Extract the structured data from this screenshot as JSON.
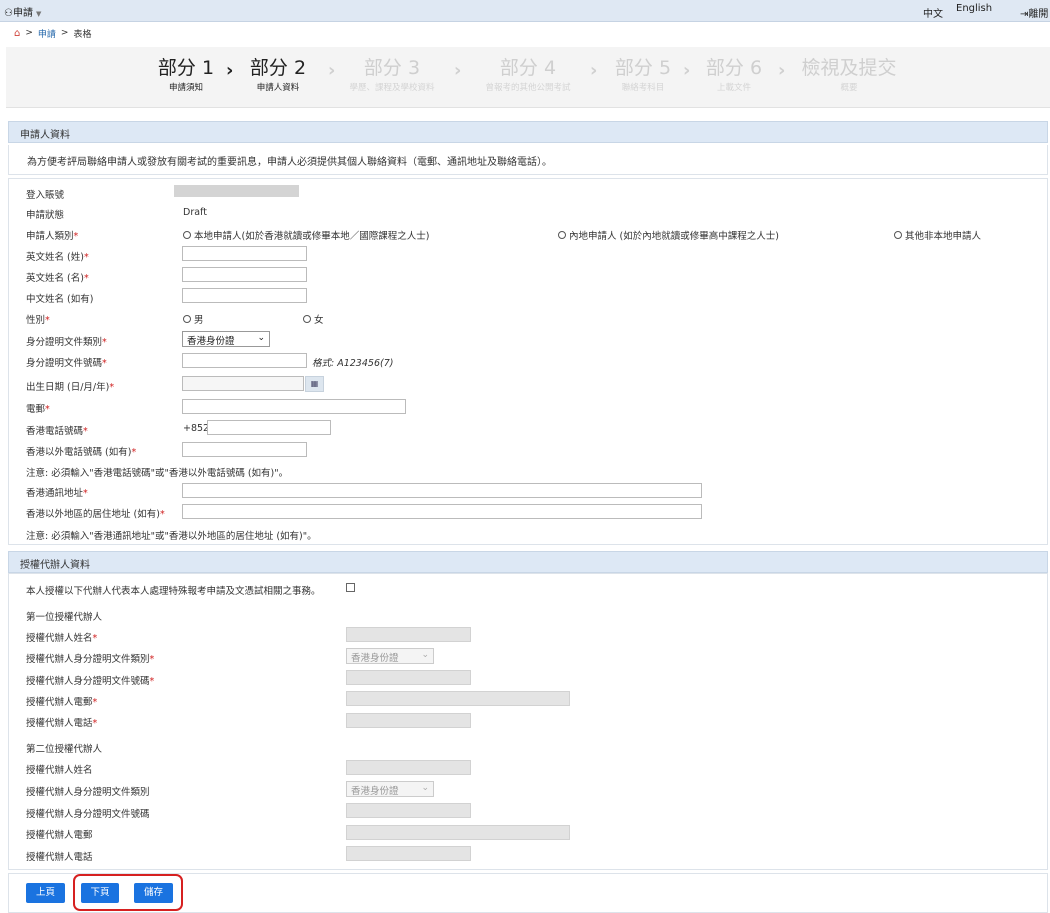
{
  "topbar": {
    "menu_label": "申請",
    "lang_zh": "中文",
    "lang_en": "English",
    "logout": "離開"
  },
  "breadcrumb": {
    "item1": "申請",
    "item2": "表格",
    "sep": ">"
  },
  "steps": [
    {
      "title": "部分 1",
      "subtitle": "申請須知"
    },
    {
      "title": "部分 2",
      "subtitle": "申請人資料"
    },
    {
      "title": "部分 3",
      "subtitle": "學歷、課程及學校資料"
    },
    {
      "title": "部分 4",
      "subtitle": "曾報考的其他公開考試"
    },
    {
      "title": "部分 5",
      "subtitle": "聯絡考科目"
    },
    {
      "title": "部分 6",
      "subtitle": "上載文件"
    },
    {
      "title": "檢視及提交",
      "subtitle": "概要"
    }
  ],
  "applicant": {
    "section_title": "申請人資料",
    "notice": "為方便考評局聯絡申請人或發放有關考試的重要訊息，申請人必須提供其個人聯絡資料（電郵、通訊地址及聯絡電話）。",
    "login_label": "登入賬號",
    "status_label": "申請狀態",
    "status_value": "Draft",
    "category_label": "申請人類別",
    "category_options": [
      "本地申請人(如於香港就讀或修畢本地／國際課程之人士)",
      "內地申請人 (如於內地就讀或修畢高中課程之人士)",
      "其他非本地申請人"
    ],
    "surname_label": "英文姓名 (姓)",
    "given_name_label": "英文姓名 (名)",
    "chinese_name_label": "中文姓名 (如有)",
    "gender_label": "性別",
    "gender_male": "男",
    "gender_female": "女",
    "id_type_label": "身分證明文件類別",
    "id_type_value": "香港身份證",
    "id_number_label": "身分證明文件號碼",
    "id_format_hint": "格式: A123456(7)",
    "dob_label": "出生日期 (日/月/年)",
    "email_label": "電郵",
    "hk_phone_label": "香港電話號碼",
    "hk_phone_prefix": "+852",
    "non_hk_phone_label": "香港以外電話號碼 (如有)",
    "phone_note": "注意: 必須輸入\"香港電話號碼\"或\"香港以外電話號碼 (如有)\"。",
    "hk_address_label": "香港通訊地址",
    "non_hk_address_label": "香港以外地區的居住地址 (如有)",
    "address_note": "注意: 必須輸入\"香港通訊地址\"或\"香港以外地區的居住地址 (如有)\"。"
  },
  "agent": {
    "section_title": "授權代辦人資料",
    "authorize_text": "本人授權以下代辦人代表本人處理特殊報考申請及文憑試相關之事務。",
    "first_heading": "第一位授權代辦人",
    "second_heading": "第二位授權代辦人",
    "name_label": "授權代辦人姓名",
    "id_type_label": "授權代辦人身分證明文件類別",
    "id_number_label": "授權代辦人身分證明文件號碼",
    "email_label": "授權代辦人電郵",
    "phone_label": "授權代辦人電話",
    "id_type_value": "香港身份證"
  },
  "footer": {
    "prev": "上頁",
    "next": "下頁",
    "save": "儲存"
  },
  "colors": {
    "accent": "#1a73e0",
    "section_bg": "#dde8f5",
    "required": "#d02020",
    "highlight": "#d62020"
  },
  "icons": {
    "home": "home-icon",
    "calendar": "calendar-icon",
    "dropdown": "chevron-down-icon"
  }
}
